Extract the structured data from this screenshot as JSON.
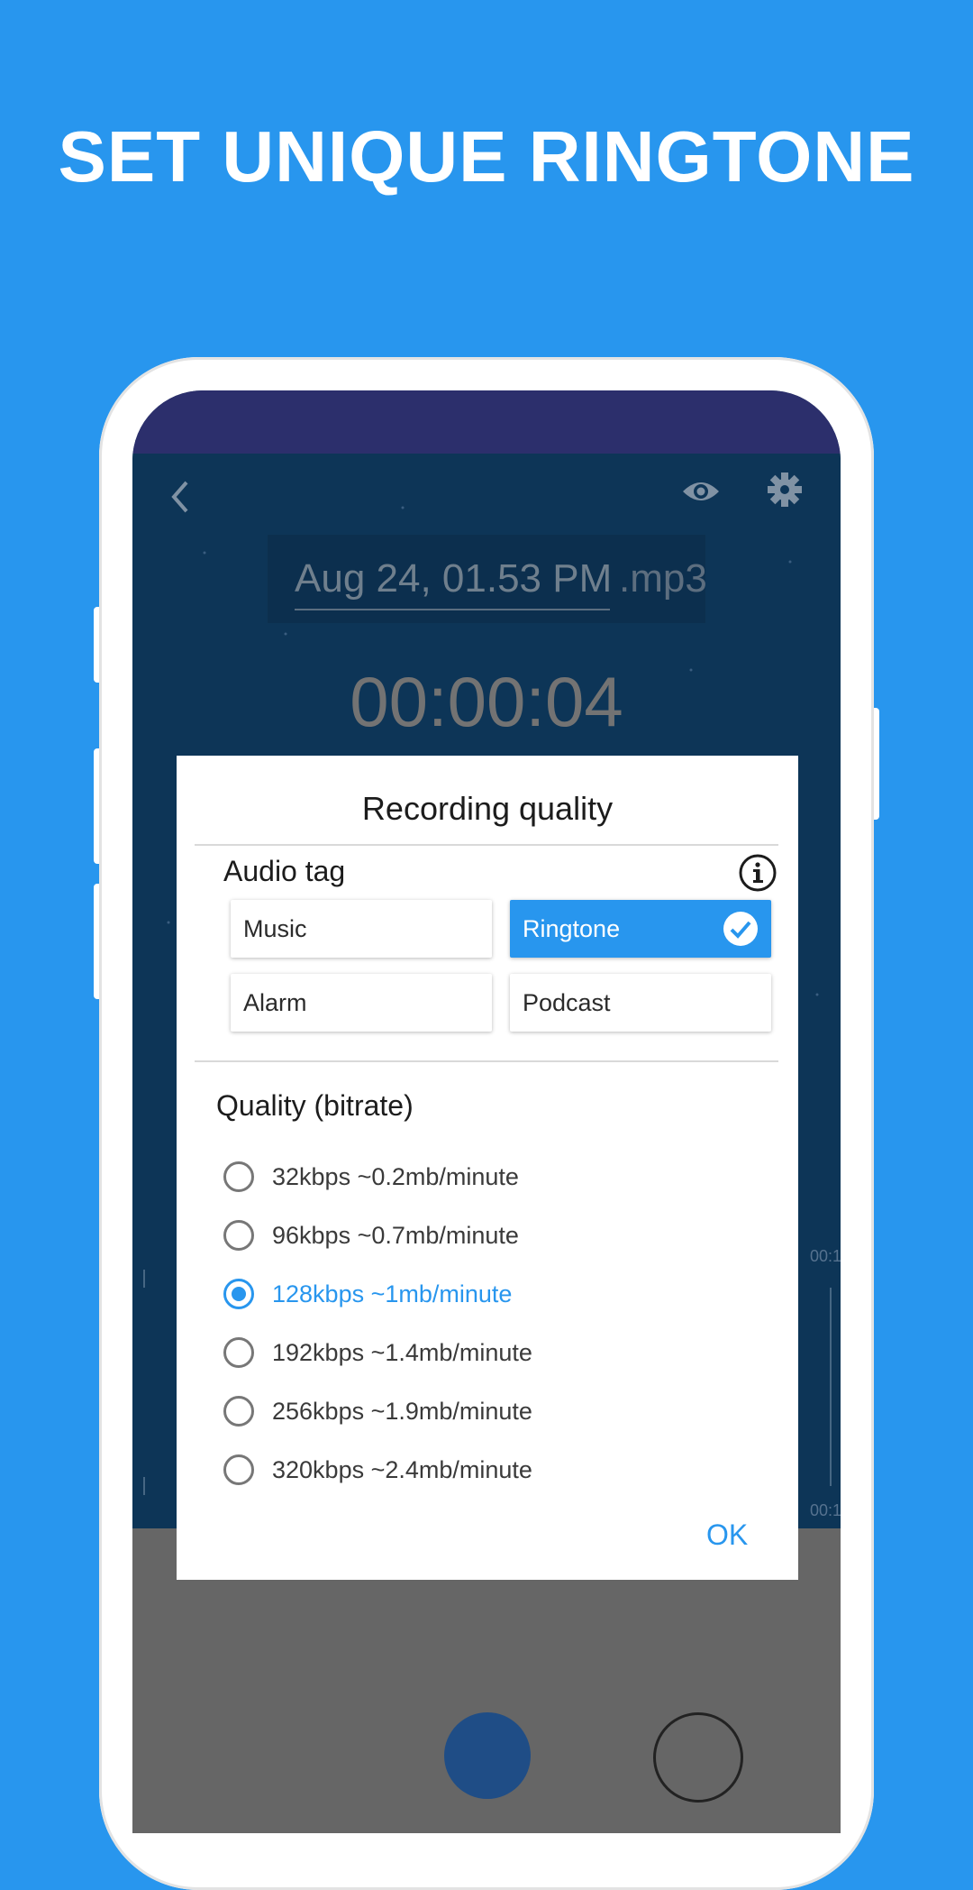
{
  "headline": "SET UNIQUE RINGTONE",
  "colors": {
    "background": "#2896ee",
    "accent": "#2896ee",
    "app_bg": "#0d3557",
    "statusbar": "#2c2f6c"
  },
  "app": {
    "icons": [
      "back-icon",
      "eye-icon",
      "gear-icon"
    ],
    "filename": "Aug 24, 01.53 PM",
    "extension": ".mp3",
    "timer": "00:00:04",
    "wave_labels": [
      "00:1",
      "00:1"
    ]
  },
  "dialog": {
    "title": "Recording quality",
    "audio_tag_label": "Audio tag",
    "tags": [
      {
        "label": "Music",
        "selected": false
      },
      {
        "label": "Ringtone",
        "selected": true
      },
      {
        "label": "Alarm",
        "selected": false
      },
      {
        "label": "Podcast",
        "selected": false
      }
    ],
    "quality_label": "Quality (bitrate)",
    "options": [
      {
        "label": "32kbps ~0.2mb/minute",
        "selected": false
      },
      {
        "label": "96kbps ~0.7mb/minute",
        "selected": false
      },
      {
        "label": "128kbps ~1mb/minute",
        "selected": true
      },
      {
        "label": "192kbps ~1.4mb/minute",
        "selected": false
      },
      {
        "label": "256kbps ~1.9mb/minute",
        "selected": false
      },
      {
        "label": "320kbps ~2.4mb/minute",
        "selected": false
      }
    ],
    "ok_label": "OK"
  }
}
